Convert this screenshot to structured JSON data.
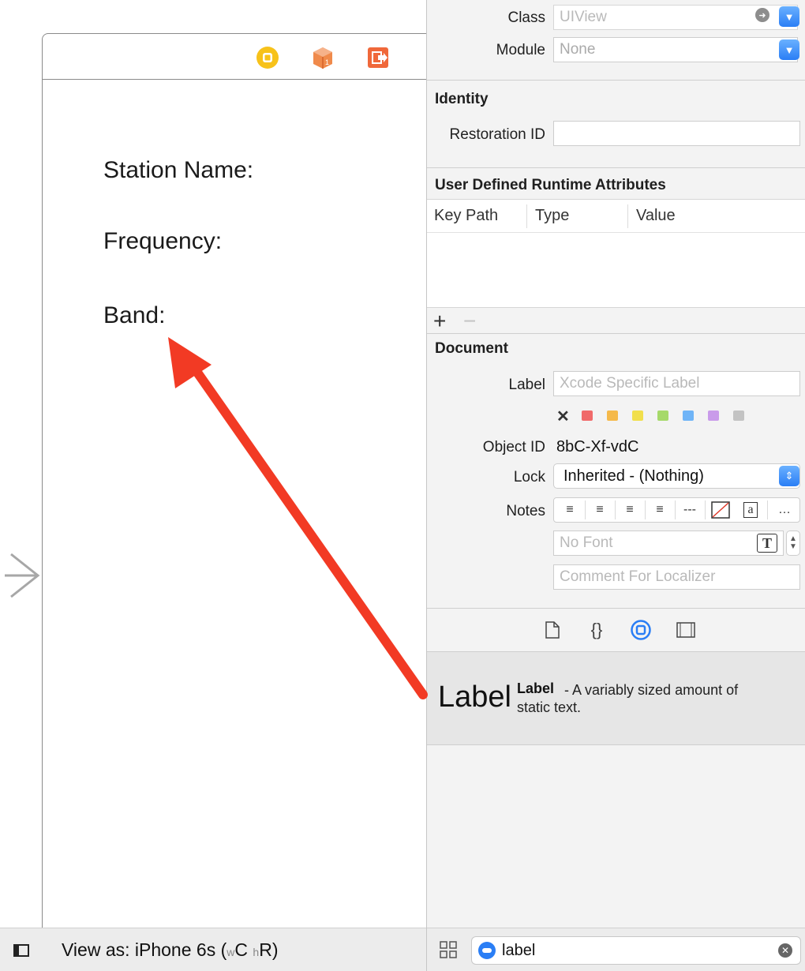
{
  "canvas": {
    "scene_labels": {
      "station": "Station Name:",
      "frequency": "Frequency:",
      "band": "Band:"
    },
    "bottom_bar": {
      "view_as_prefix": "View as: iPhone 6s",
      "open_paren": "(",
      "w_size": "w",
      "w_class": "C",
      "h_size": "h",
      "h_class": "R",
      "close_paren": ")"
    }
  },
  "inspector": {
    "custom_class": {
      "class_label": "Class",
      "class_placeholder": "UIView",
      "module_label": "Module",
      "module_placeholder": "None"
    },
    "identity": {
      "header": "Identity",
      "restoration_label": "Restoration ID",
      "restoration_value": ""
    },
    "runtime_attributes": {
      "header": "User Defined Runtime Attributes",
      "columns": [
        "Key Path",
        "Type",
        "Value"
      ],
      "add": "+",
      "remove": "−"
    },
    "document": {
      "header": "Document",
      "label_label": "Label",
      "label_placeholder": "Xcode Specific Label",
      "clear_color": "✕",
      "label_colors": [
        "#f06a6a",
        "#f5b94a",
        "#f1df4b",
        "#a6d96a",
        "#6fb4f7",
        "#c99bea",
        "#c3c3c3"
      ],
      "object_id_label": "Object ID",
      "object_id_value": "8bC-Xf-vdC",
      "lock_label": "Lock",
      "lock_value": "Inherited - (Nothing)",
      "notes_label": "Notes",
      "notes_tools": [
        "≡",
        "≡",
        "≡",
        "≡",
        "---",
        "⧄",
        "a",
        "…"
      ],
      "font_placeholder": "No Font",
      "font_icon": "T",
      "comment_placeholder": "Comment For Localizer"
    },
    "library": {
      "tab_icons": [
        "file-icon",
        "braces-icon",
        "object-icon",
        "media-icon"
      ],
      "braces": "{}",
      "item_icon_text": "Label",
      "item_title": "Label",
      "item_desc": "- A variably sized amount of",
      "item_desc_2": "static text.",
      "filter_value": "label",
      "accent": "#2a7ef5"
    }
  },
  "annotation": {
    "arrow_color": "#f23a24"
  }
}
